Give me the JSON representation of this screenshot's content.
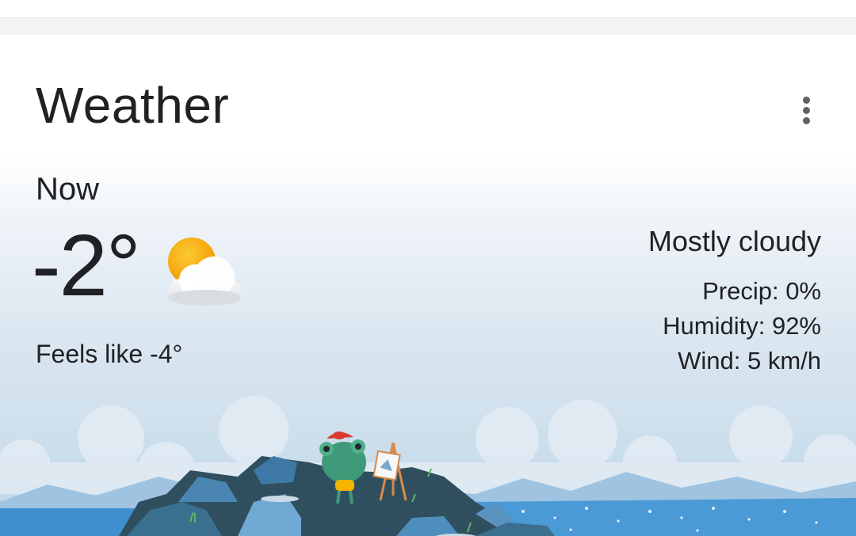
{
  "card": {
    "title": "Weather",
    "menu_icon": "more-vert-icon"
  },
  "current": {
    "label": "Now",
    "temperature": "-2°",
    "feels_like": "Feels like -4°",
    "condition": "Mostly cloudy",
    "condition_icon": "partly-cloudy-icon"
  },
  "details": [
    {
      "label": "Precip:",
      "value": "0%"
    },
    {
      "label": "Humidity:",
      "value": "92%"
    },
    {
      "label": "Wind:",
      "value": "5 km/h"
    }
  ],
  "illustration": {
    "name": "frog-painting-on-hill-illustration"
  },
  "colors": {
    "text": "#202124",
    "icon_gray": "#5f6368",
    "sun": "#f9a825",
    "sky_top": "#ffffff",
    "sky_bottom": "#b9d3e6",
    "water": "#3f8fcf"
  }
}
